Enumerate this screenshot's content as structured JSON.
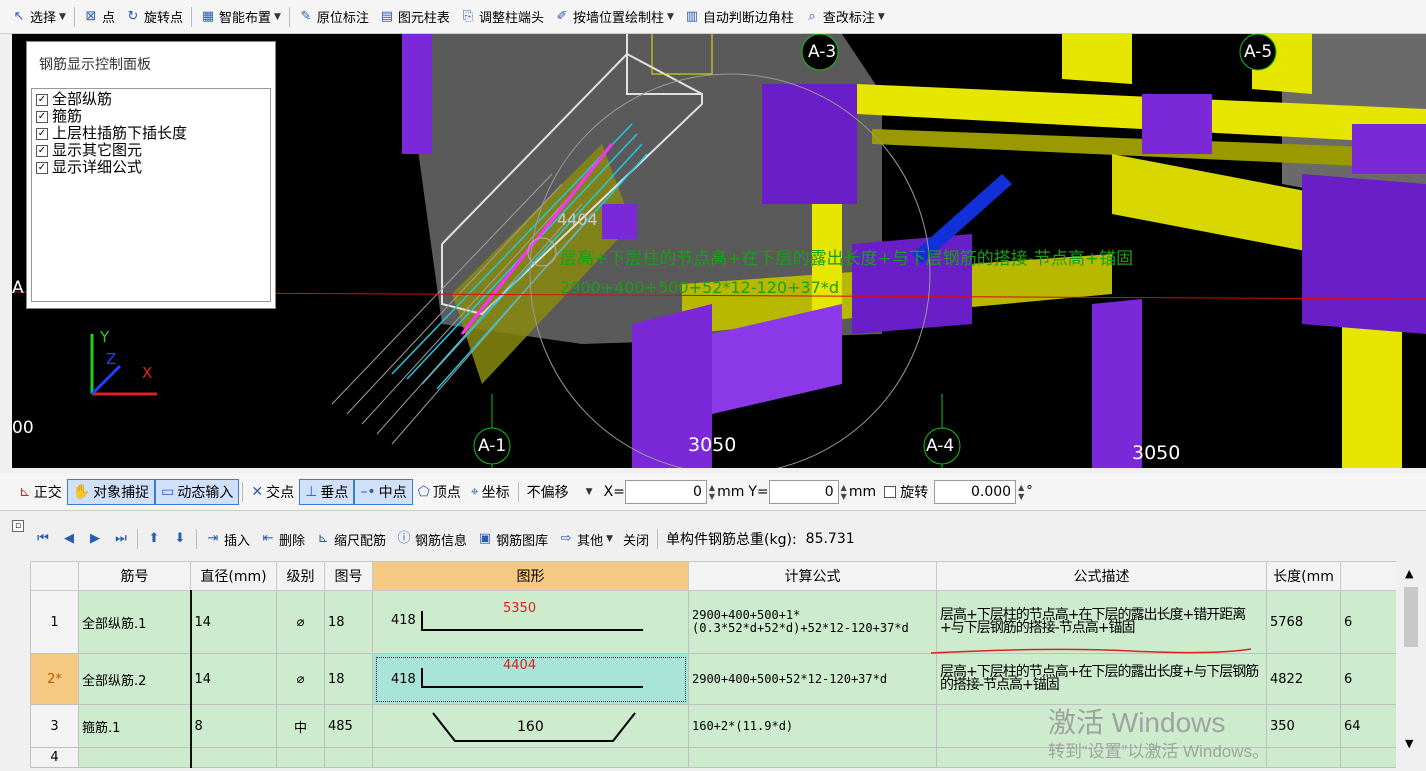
{
  "top_toolbar": {
    "items": [
      {
        "label": "选择",
        "icon": "cursor-icon",
        "caret": true
      },
      {
        "label": "点",
        "icon": "point-icon"
      },
      {
        "label": "旋转点",
        "icon": "rotate-point-icon"
      },
      {
        "label": "智能布置",
        "icon": "smart-layout-icon",
        "caret": true
      },
      {
        "label": "原位标注",
        "icon": "inplace-annotate-icon"
      },
      {
        "label": "图元柱表",
        "icon": "column-table-icon"
      },
      {
        "label": "调整柱端头",
        "icon": "adjust-column-end-icon"
      },
      {
        "label": "按墙位置绘制柱",
        "icon": "draw-column-by-wall-icon",
        "caret": true
      },
      {
        "label": "自动判断边角柱",
        "icon": "auto-corner-column-icon"
      },
      {
        "label": "查改标注",
        "icon": "check-annotate-icon",
        "caret": true
      }
    ]
  },
  "viewport": {
    "axis_labels": [
      "A-3",
      "A-5",
      "A-1",
      "A-4"
    ],
    "dim_left": "3050",
    "dim_right": "3050",
    "edge_left_label": "A",
    "edge_bottom_left": "00",
    "length_label": "4404",
    "formula_desc": "层高+下层柱的节点高+在下层的露出长度+与下层钢筋的搭接-节点高+锚固",
    "formula": "2900+400+500+52*12-120+37*d",
    "axis_x": "X",
    "axis_y": "Y",
    "axis_z": "Z"
  },
  "control_panel": {
    "title": "钢筋显示控制面板",
    "items": [
      {
        "label": "全部纵筋",
        "checked": true
      },
      {
        "label": "箍筋",
        "checked": true
      },
      {
        "label": "上层柱插筋下插长度",
        "checked": true
      },
      {
        "label": "显示其它图元",
        "checked": true
      },
      {
        "label": "显示详细公式",
        "checked": true
      }
    ]
  },
  "snap_toolbar": {
    "ortho": "正交",
    "object_snap": "对象捕捉",
    "dynamic_input": "动态输入",
    "intersection": "交点",
    "perpendicular": "垂点",
    "midpoint": "中点",
    "vertex": "顶点",
    "coordinate": "坐标",
    "offset_select": "不偏移",
    "x_label": "X=",
    "x_value": "0",
    "unit_x": "mm",
    "y_label": "Y=",
    "y_value": "0",
    "unit_y": "mm",
    "rotate_label": "旋转",
    "rotate_value": "0.000",
    "degree": "°"
  },
  "rebar_toolbar": {
    "insert": "插入",
    "delete": "删除",
    "scale_rebar": "缩尺配筋",
    "rebar_info": "钢筋信息",
    "rebar_library": "钢筋图库",
    "other": "其他",
    "close": "关闭",
    "total_weight_label": "单构件钢筋总重(kg):",
    "total_weight_value": "85.731"
  },
  "table": {
    "headers": [
      "筋号",
      "直径(mm)",
      "级别",
      "图号",
      "图形",
      "计算公式",
      "公式描述",
      "长度(mm",
      ""
    ],
    "rows": [
      {
        "idx": "1",
        "name": "全部纵筋.1",
        "diameter": "14",
        "grade": "⌀",
        "fig": "18",
        "shape_left": "418",
        "shape_top": "5350",
        "formula": "2900+400+500+1*(0.3*52*d+52*d)+52*12-120+37*d",
        "desc": "层高+下层柱的节点高+在下层的露出长度+错开距离+与下层钢筋的搭接-节点高+锚固",
        "length": "5768",
        "count": "6"
      },
      {
        "idx": "2*",
        "name": "全部纵筋.2",
        "diameter": "14",
        "grade": "⌀",
        "fig": "18",
        "shape_left": "418",
        "shape_top": "4404",
        "formula": "2900+400+500+52*12-120+37*d",
        "desc": "层高+下层柱的节点高+在下层的露出长度+与下层钢筋的搭接-节点高+锚固",
        "length": "4822",
        "count": "6"
      },
      {
        "idx": "3",
        "name": "箍筋.1",
        "diameter": "8",
        "grade": "中",
        "fig": "485",
        "shape_mid": "160",
        "formula": "160+2*(11.9*d)",
        "desc": "",
        "length": "350",
        "count": "64"
      },
      {
        "idx": "4"
      }
    ]
  },
  "watermark": {
    "line1": "激活 Windows",
    "line2": "转到“设置”以激活 Windows。"
  }
}
